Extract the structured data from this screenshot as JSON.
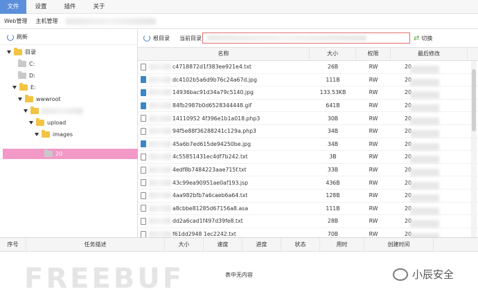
{
  "menu": [
    "文件",
    "设置",
    "插件",
    "关于"
  ],
  "tabs": [
    "Web管理",
    "主机管理"
  ],
  "left_toolbar": {
    "refresh": "刷新"
  },
  "tree": {
    "root": "目录",
    "drive_c": "C:",
    "drive_d": "D:",
    "drive_e": "E:",
    "wwwroot": "wwwroot",
    "upload": "upload",
    "images": "images",
    "selected_partial": "20"
  },
  "right_toolbar": {
    "root_dir": "根目录",
    "current_dir_label": "当前目录:",
    "switch": "切换"
  },
  "table_headers": {
    "name": "名称",
    "size": "大小",
    "perm": "权限",
    "time": "最后修改"
  },
  "files": [
    {
      "name": "c4718872d1f383ee921e4.txt",
      "size": "26B",
      "perm": "RW",
      "time_prefix": "20",
      "type": "file"
    },
    {
      "name": "dc4102b5a6d9b76c24a67d.jpg",
      "size": "111B",
      "perm": "RW",
      "time_prefix": "20",
      "type": "img"
    },
    {
      "name": "14936bac91d34a79c5140.jpg",
      "size": "133.53KB",
      "perm": "RW",
      "time_prefix": "20",
      "type": "img"
    },
    {
      "name": "84fb2987b0d6528344448.gif",
      "size": "641B",
      "perm": "RW",
      "time_prefix": "20",
      "type": "img"
    },
    {
      "name": "14110952 4f396e1b1a018.php3",
      "size": "30B",
      "perm": "RW",
      "time_prefix": "20",
      "type": "file"
    },
    {
      "name": "94f5e88f36288241c129a.php3",
      "size": "34B",
      "perm": "RW",
      "time_prefix": "20",
      "type": "file"
    },
    {
      "name": "45a6b7ed615de94250be.jpg",
      "size": "34B",
      "perm": "RW",
      "time_prefix": "20",
      "type": "img"
    },
    {
      "name": "4c55851431ec4df7b242.txt",
      "size": "3B",
      "perm": "RW",
      "time_prefix": "20",
      "type": "file"
    },
    {
      "name": "4edf8b7484223aae715f.txt",
      "size": "33B",
      "perm": "RW",
      "time_prefix": "20",
      "type": "file"
    },
    {
      "name": "43c99ea90951ae0af193.jsp",
      "size": "436B",
      "perm": "RW",
      "time_prefix": "20",
      "type": "file"
    },
    {
      "name": "4aa982bfb7a6caeb6a64.txt",
      "size": "128B",
      "perm": "RW",
      "time_prefix": "20",
      "type": "file"
    },
    {
      "name": "a8cbbe81285d67156a8.asa",
      "size": "111B",
      "perm": "RW",
      "time_prefix": "20",
      "type": "file"
    },
    {
      "name": "dd2a6cad1f497d39fe8.txt",
      "size": "28B",
      "perm": "RW",
      "time_prefix": "20",
      "type": "file"
    },
    {
      "name": "f61dd2948 1ec2242.txt",
      "size": "70B",
      "perm": "RW",
      "time_prefix": "20",
      "type": "file"
    }
  ],
  "task_headers": [
    "序号",
    "任务描述",
    "大小",
    "速度",
    "进度",
    "状态",
    "用时",
    "创建时间"
  ],
  "task_empty": "表中无内容",
  "watermarks": {
    "freebuf": "FREEBUF",
    "wechat": "小辰安全"
  }
}
